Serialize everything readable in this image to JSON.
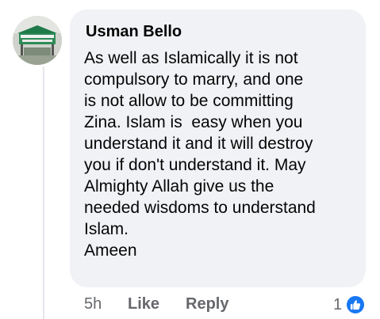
{
  "comment": {
    "author": "Usman Bello",
    "lines": [
      "As well as Islamically it is not",
      "compulsory to marry, and one",
      "is not allow to be committing",
      "Zina. Islam is  easy when you",
      "understand it and it will destroy",
      "you if don't understand it. May",
      "Almighty Allah give us the",
      "needed wisdoms to understand",
      "Islam.",
      "Ameen"
    ],
    "avatar_icon": "profile-photo-icon"
  },
  "actions": {
    "timestamp": "5h",
    "like_label": "Like",
    "reply_label": "Reply"
  },
  "reactions": {
    "count": "1",
    "icon": "like-thumb-icon",
    "color": "#1877f2"
  },
  "colors": {
    "bubble": "#f0f2f5",
    "text": "#050505",
    "secondary_text": "#65676b",
    "accent": "#1877f2"
  }
}
